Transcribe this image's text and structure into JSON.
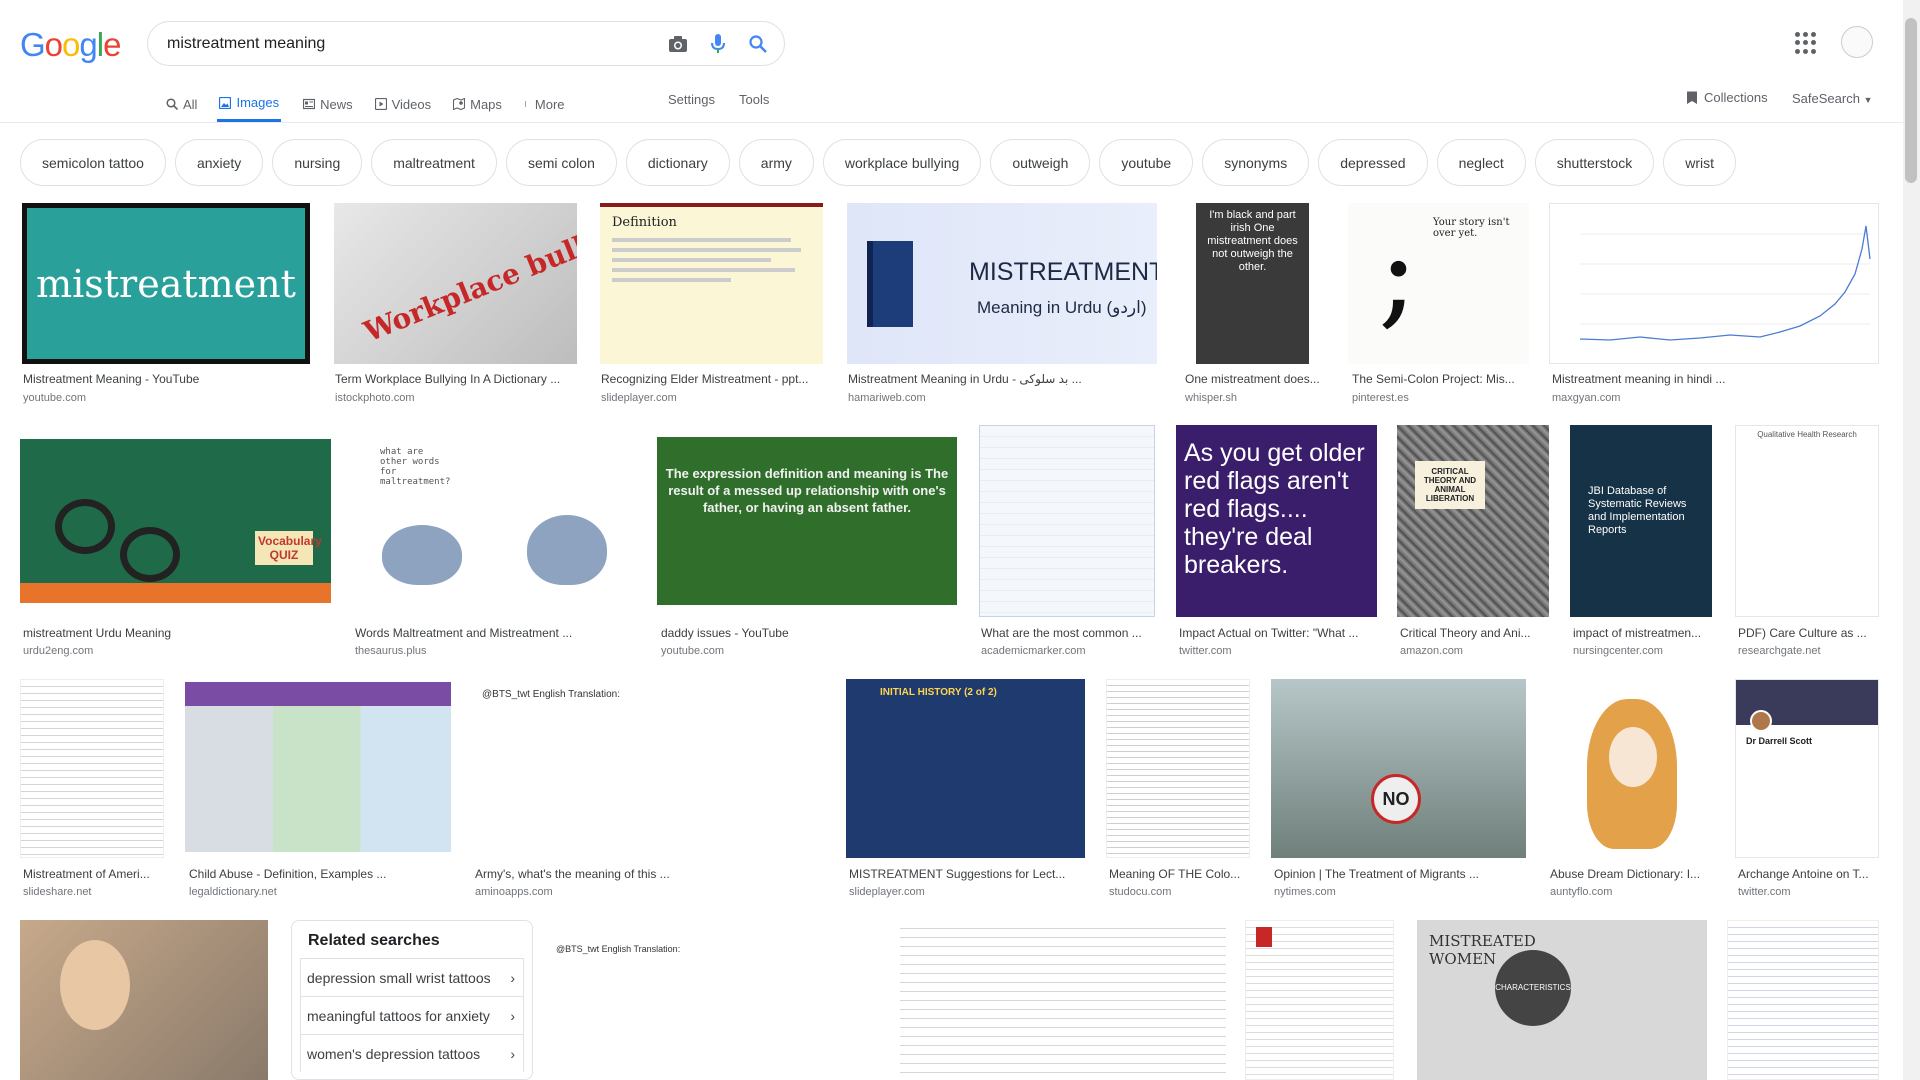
{
  "search": {
    "query": "mistreatment meaning"
  },
  "tabs": [
    {
      "label": "All",
      "icon": "search-icon"
    },
    {
      "label": "Images",
      "icon": "image-icon"
    },
    {
      "label": "News",
      "icon": "news-icon"
    },
    {
      "label": "Videos",
      "icon": "video-icon"
    },
    {
      "label": "Maps",
      "icon": "map-icon"
    },
    {
      "label": "More",
      "icon": "more-vert-icon"
    }
  ],
  "tools": {
    "settings": "Settings",
    "tools": "Tools",
    "collections": "Collections",
    "safesearch": "SafeSearch"
  },
  "chips": [
    "semicolon tattoo",
    "anxiety",
    "nursing",
    "maltreatment",
    "semi colon",
    "dictionary",
    "army",
    "workplace bullying",
    "outweigh",
    "youtube",
    "synonyms",
    "depressed",
    "neglect",
    "shutterstock",
    "wrist"
  ],
  "results": [
    {
      "title": "Mistreatment Meaning - YouTube",
      "source": "youtube.com",
      "text": "mistreatment"
    },
    {
      "title": "Term Workplace Bullying In A Dictionary ...",
      "source": "istockphoto.com",
      "text": "Workplace bullying:"
    },
    {
      "title": "Recognizing Elder Mistreatment - ppt...",
      "source": "slideplayer.com",
      "text": "Definition"
    },
    {
      "title": "Mistreatment Meaning in Urdu - بد سلوکی ...",
      "source": "hamariweb.com",
      "text": "MISTREATMENT",
      "text2": "Meaning in Urdu (اردو)"
    },
    {
      "title": "One mistreatment does...",
      "source": "whisper.sh",
      "text": "I'm black and part irish One mistreatment does not outweigh the other."
    },
    {
      "title": "The Semi-Colon Project: Mis...",
      "source": "pinterest.es",
      "text": "Your story isn't over yet."
    },
    {
      "title": "Mistreatment meaning in hindi ...",
      "source": "maxgyan.com"
    },
    {
      "title": "mistreatment Urdu Meaning",
      "source": "urdu2eng.com",
      "text": "Vocabulary QUIZ"
    },
    {
      "title": "Words Maltreatment and Mistreatment ...",
      "source": "thesaurus.plus",
      "text": "what are other words for maltreatment?"
    },
    {
      "title": "daddy issues - YouTube",
      "source": "youtube.com",
      "text": "The expression definition and meaning is The result of a messed up relationship with one's father, or having an absent father."
    },
    {
      "title": "What are the most common ...",
      "source": "academicmarker.com"
    },
    {
      "title": "Impact Actual on Twitter: \"What ...",
      "source": "twitter.com",
      "text": "As you get older red flags aren't red flags.... they're deal breakers."
    },
    {
      "title": "Critical Theory and Ani...",
      "source": "amazon.com",
      "text": "CRITICAL THEORY AND ANIMAL LIBERATION"
    },
    {
      "title": "impact of mistreatmen...",
      "source": "nursingcenter.com",
      "text": "JBI Database of Systematic Reviews and Implementation Reports"
    },
    {
      "title": "PDF) Care Culture as ...",
      "source": "researchgate.net",
      "text": "Qualitative Health Research"
    },
    {
      "title": "Mistreatment of Ameri...",
      "source": "slideshare.net"
    },
    {
      "title": "Child Abuse - Definition, Examples ...",
      "source": "legaldictionary.net"
    },
    {
      "title": "Army's, what's the meaning of this ...",
      "source": "aminoapps.com",
      "text": "@BTS_twt English Translation:"
    },
    {
      "title": "MISTREATMENT Suggestions for Lect...",
      "source": "slideplayer.com",
      "text": "INITIAL HISTORY (2 of 2)"
    },
    {
      "title": "Meaning OF THE Colo...",
      "source": "studocu.com"
    },
    {
      "title": "Opinion | The Treatment of Migrants ...",
      "source": "nytimes.com",
      "text": "NO"
    },
    {
      "title": "Abuse Dream Dictionary: I...",
      "source": "auntyflo.com"
    },
    {
      "title": "Archange Antoine on T...",
      "source": "twitter.com",
      "text": "Dr Darrell Scott"
    }
  ],
  "bottom_row": [
    {
      "text": "@BTS_twt English Translation:"
    },
    {
      "text": "MISTREATED WOMEN",
      "text2": "CHARACTERISTICS"
    }
  ],
  "related": {
    "title": "Related searches",
    "items": [
      "depression small wrist tattoos",
      "meaningful tattoos for anxiety",
      "women's depression tattoos"
    ]
  },
  "colors": {
    "accent": "#1a73e8",
    "teal": "#2aa09a",
    "darkgreen": "#1b5e3a",
    "navy": "#1c3d7a"
  }
}
